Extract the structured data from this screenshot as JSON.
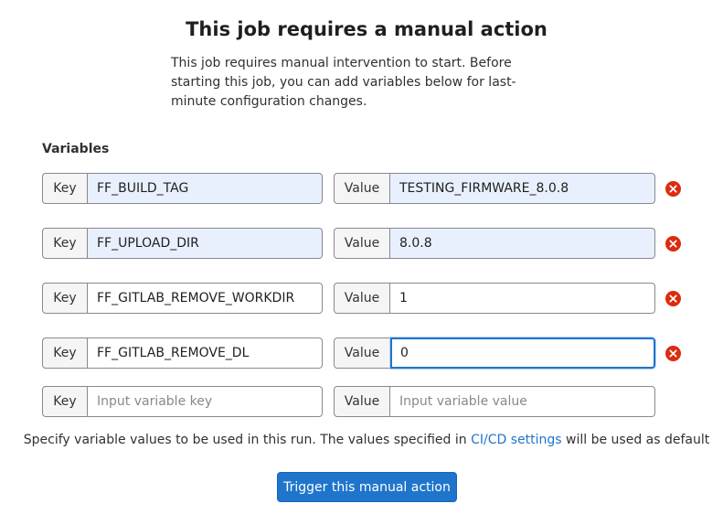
{
  "title": "This job requires a manual action",
  "intro": "This job requires manual intervention to start. Before starting this job, you can add variables below for last-minute configuration changes.",
  "variables_heading": "Variables",
  "key_label": "Key",
  "value_label": "Value",
  "variables": [
    {
      "key": "FF_BUILD_TAG",
      "value": "TESTING_FIRMWARE_8.0.8"
    },
    {
      "key": "FF_UPLOAD_DIR",
      "value": "8.0.8"
    },
    {
      "key": "FF_GITLAB_REMOVE_WORKDIR",
      "value": "1"
    },
    {
      "key": "FF_GITLAB_REMOVE_DL",
      "value": "0"
    }
  ],
  "new_variable": {
    "key_placeholder": "Input variable key",
    "value_placeholder": "Input variable value"
  },
  "help": {
    "prefix": "Specify variable values to be used in this run. The values specified in ",
    "link": "CI/CD settings",
    "suffix": " will be used as default"
  },
  "trigger_label": "Trigger this manual action",
  "colors": {
    "accent": "#1f75cb",
    "danger": "#dd2b0e",
    "autofill": "#e8f0fe"
  }
}
